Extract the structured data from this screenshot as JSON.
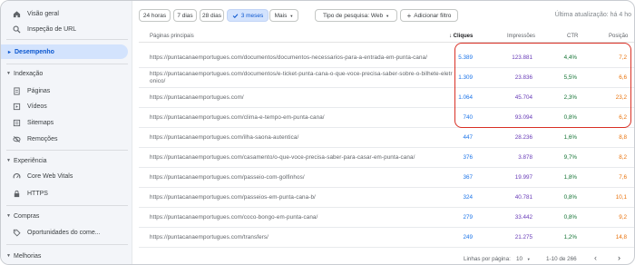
{
  "sidebar": {
    "top_items": [
      {
        "label": "Visão geral",
        "icon": "home-icon"
      },
      {
        "label": "Inspeção de URL",
        "icon": "search-icon"
      }
    ],
    "active_item": {
      "label": "Desempenho",
      "icon": "trending-icon"
    },
    "sections": [
      {
        "label": "Indexação",
        "items": [
          {
            "label": "Páginas",
            "icon": "pages-icon"
          },
          {
            "label": "Vídeos",
            "icon": "video-icon"
          },
          {
            "label": "Sitemaps",
            "icon": "sitemap-icon"
          },
          {
            "label": "Remoções",
            "icon": "eye-off-icon"
          }
        ]
      },
      {
        "label": "Experiência",
        "items": [
          {
            "label": "Core Web Vitals",
            "icon": "speed-icon"
          },
          {
            "label": "HTTPS",
            "icon": "lock-icon"
          }
        ]
      },
      {
        "label": "Compras",
        "items": [
          {
            "label": "Oportunidades do come...",
            "icon": "tag-icon"
          }
        ]
      },
      {
        "label": "Melhorias",
        "items": []
      }
    ]
  },
  "toolbar": {
    "date_ranges": [
      "24 horas",
      "7 dias",
      "28 dias",
      "3 meses",
      "Mais"
    ],
    "selected_range": "3 meses",
    "search_type": "Tipo de pesquisa: Web",
    "add_filter": "Adicionar filtro",
    "last_update": "Última atualização: há 4 ho"
  },
  "table": {
    "headers": {
      "page": "Páginas principais",
      "clicks": "Cliques",
      "impressions": "Impressões",
      "ctr": "CTR",
      "position": "Posição"
    },
    "rows": [
      {
        "url": "https://puntacanaemportugues.com/documentos/documentos-necessarios-para-a-entrada-em-punta-cana/",
        "clicks": "5.389",
        "impressions": "123.881",
        "ctr": "4,4%",
        "position": "7,2"
      },
      {
        "url": "https://puntacanaemportugues.com/documentos/e-ticket-punta-cana-o-que-voce-precisa-saber-sobre-o-bilhete-eletr",
        "url2": "onico/",
        "clicks": "1.309",
        "impressions": "23.836",
        "ctr": "5,5%",
        "position": "6,6"
      },
      {
        "url": "https://puntacanaemportugues.com/",
        "clicks": "1.064",
        "impressions": "45.704",
        "ctr": "2,3%",
        "position": "23,2"
      },
      {
        "url": "https://puntacanaemportugues.com/clima-e-tempo-em-punta-cana/",
        "clicks": "740",
        "impressions": "93.094",
        "ctr": "0,8%",
        "position": "6,2"
      },
      {
        "url": "https://puntacanaemportugues.com/ilha-saona-autentica/",
        "clicks": "447",
        "impressions": "28.236",
        "ctr": "1,6%",
        "position": "8,8"
      },
      {
        "url": "https://puntacanaemportugues.com/casamento/o-que-voce-precisa-saber-para-casar-em-punta-cana/",
        "clicks": "376",
        "impressions": "3.878",
        "ctr": "9,7%",
        "position": "8,2"
      },
      {
        "url": "https://puntacanaemportugues.com/passeio-com-golfinhos/",
        "clicks": "367",
        "impressions": "19.997",
        "ctr": "1,8%",
        "position": "7,6"
      },
      {
        "url": "https://puntacanaemportugues.com/passeios-em-punta-cana-b/",
        "clicks": "324",
        "impressions": "40.781",
        "ctr": "0,8%",
        "position": "10,1"
      },
      {
        "url": "https://puntacanaemportugues.com/coco-bongo-em-punta-cana/",
        "clicks": "279",
        "impressions": "33.442",
        "ctr": "0,8%",
        "position": "9,2"
      },
      {
        "url": "https://puntacanaemportugues.com/transfers/",
        "clicks": "249",
        "impressions": "21.275",
        "ctr": "1,2%",
        "position": "14,8"
      }
    ]
  },
  "footer": {
    "rows_per_page_label": "Linhas por página:",
    "rows_per_page": "10",
    "range": "1-10 de 266"
  }
}
